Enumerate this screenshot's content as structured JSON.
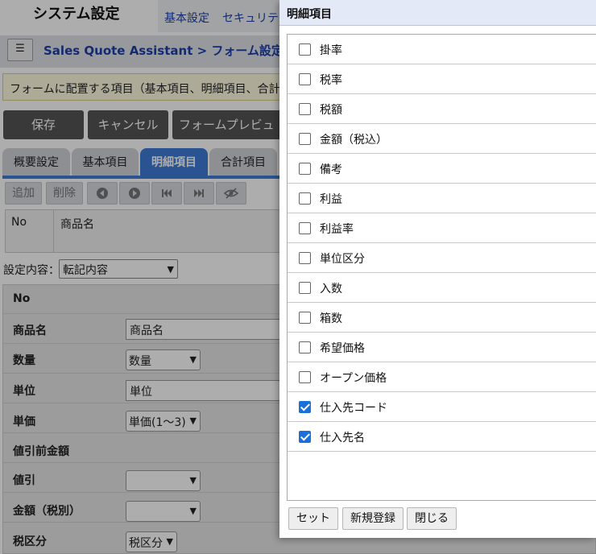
{
  "background": {
    "app_title": "システム設定",
    "top_tabs": [
      "基本設定",
      "セキュリテ"
    ],
    "menu_icon": "☰",
    "breadcrumb": "Sales Quote Assistant > フォーム設定／フ",
    "notice": "フォームに配置する項目（基本項目、明細項目、合計",
    "actions": {
      "save": "保存",
      "cancel": "キャンセル",
      "preview": "フォームプレビュー"
    },
    "sub_tabs": [
      "概要設定",
      "基本項目",
      "明細項目",
      "合計項目"
    ],
    "tools": {
      "add": "追加",
      "delete": "削除"
    },
    "grid_head": {
      "no": "No",
      "name": "商品名"
    },
    "setting": {
      "label": "設定内容：",
      "value": "転記内容"
    },
    "rows": [
      {
        "label": "No"
      },
      {
        "label": "商品名",
        "value": "商品名"
      },
      {
        "label": "数量",
        "value": "数量"
      },
      {
        "label": "単位",
        "value": "単位"
      },
      {
        "label": "単価",
        "value": "単価(1～3)"
      },
      {
        "label": "値引前金額"
      },
      {
        "label": "値引",
        "value": ""
      },
      {
        "label": "金額（税別）",
        "value": ""
      },
      {
        "label": "税区分",
        "value": "税区分"
      }
    ]
  },
  "dialog": {
    "title": "明細項目",
    "items": [
      {
        "label": "掛率",
        "checked": false
      },
      {
        "label": "税率",
        "checked": false
      },
      {
        "label": "税額",
        "checked": false
      },
      {
        "label": "金額（税込）",
        "checked": false
      },
      {
        "label": "備考",
        "checked": false
      },
      {
        "label": "利益",
        "checked": false
      },
      {
        "label": "利益率",
        "checked": false
      },
      {
        "label": "単位区分",
        "checked": false
      },
      {
        "label": "入数",
        "checked": false
      },
      {
        "label": "箱数",
        "checked": false
      },
      {
        "label": "希望価格",
        "checked": false
      },
      {
        "label": "オープン価格",
        "checked": false
      },
      {
        "label": "仕入先コード",
        "checked": true
      },
      {
        "label": "仕入先名",
        "checked": true
      }
    ],
    "buttons": {
      "set": "セット",
      "new": "新規登録",
      "close": "閉じる"
    }
  }
}
